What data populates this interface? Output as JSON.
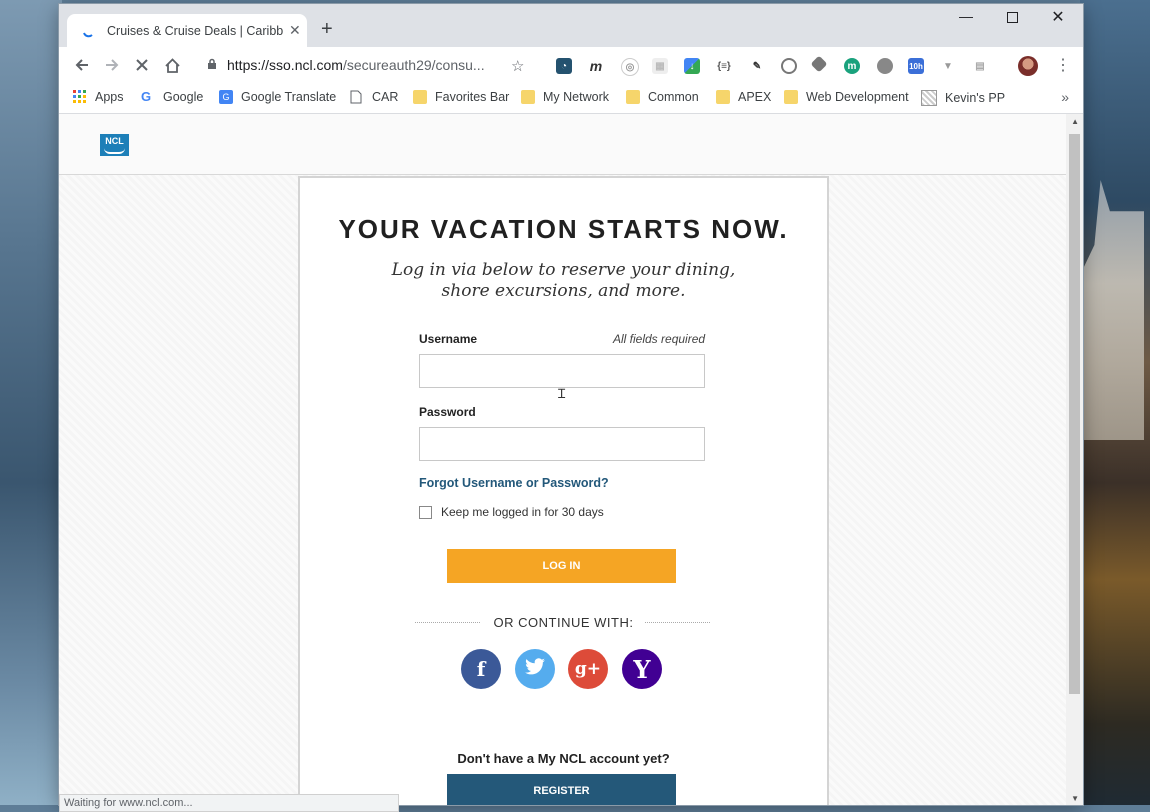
{
  "browser": {
    "tab_title": "Cruises & Cruise Deals | Caribbea",
    "url_host": "https://sso.ncl.com",
    "url_path": "/secureauth29/consu...",
    "status_text": "Waiting for www.ncl.com..."
  },
  "bookmarks": [
    {
      "label": "Apps",
      "icon": "apps-grid-icon"
    },
    {
      "label": "Google",
      "icon": "google-icon"
    },
    {
      "label": "Google Translate",
      "icon": "translate-icon"
    },
    {
      "label": "CAR",
      "icon": "page-icon"
    },
    {
      "label": "Favorites Bar",
      "icon": "folder-icon"
    },
    {
      "label": "My Network",
      "icon": "folder-icon"
    },
    {
      "label": "Common",
      "icon": "folder-icon"
    },
    {
      "label": "APEX",
      "icon": "folder-icon"
    },
    {
      "label": "Web Development",
      "icon": "folder-icon"
    },
    {
      "label": "Kevin's PP",
      "icon": "site-icon"
    }
  ],
  "page": {
    "logo_text": "NCL",
    "headline": "YOUR VACATION STARTS NOW.",
    "sub_line1": "Log in via below to reserve your dining,",
    "sub_line2": "shore excursions, and more.",
    "username_label": "Username",
    "required_note": "All fields required",
    "password_label": "Password",
    "forgot_link": "Forgot Username or Password?",
    "keep_logged": "Keep me logged in for 30 days",
    "login_button": "LOG IN",
    "or_continue": "OR CONTINUE WITH:",
    "social": [
      {
        "name": "facebook",
        "glyph": "f",
        "color": "#3b5998"
      },
      {
        "name": "twitter",
        "glyph": "🐦",
        "color": "#55acee"
      },
      {
        "name": "google-plus",
        "glyph": "g+",
        "color": "#dd4b39"
      },
      {
        "name": "yahoo",
        "glyph": "Y",
        "color": "#410093"
      }
    ],
    "no_account": "Don't have a My NCL account yet?",
    "register_button": "REGISTER"
  },
  "colors": {
    "login_orange": "#f5a524",
    "register_blue": "#245879",
    "link_blue": "#23587a",
    "ncl_blue": "#1d7fb8"
  }
}
